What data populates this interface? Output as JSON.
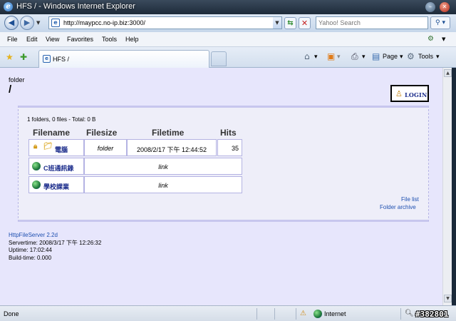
{
  "window": {
    "title": "HFS / - Windows Internet Explorer"
  },
  "address_bar": {
    "url": "http://maypcc.no-ip.biz:3000/",
    "search_placeholder": "Yahoo! Search"
  },
  "menu": {
    "items": [
      "File",
      "Edit",
      "View",
      "Favorites",
      "Tools",
      "Help"
    ]
  },
  "tabs": {
    "active_label": "HFS /"
  },
  "command_bar": {
    "page_label": "Page",
    "tools_label": "Tools"
  },
  "page": {
    "folder_label": "folder",
    "folder_path": "/",
    "login_label": "LOGIN",
    "summary": "1 folders, 0 files - Total: 0 B",
    "columns": [
      "Filename",
      "Filesize",
      "Filetime",
      "Hits"
    ],
    "rows": [
      {
        "name": "電腦",
        "size": "folder",
        "time": "2008/2/17 下午 12:44:52",
        "hits": "35",
        "type": "folder"
      },
      {
        "name": "C班通訊錄",
        "size": "link",
        "type": "link"
      },
      {
        "name": "學校課業",
        "size": "link",
        "type": "link"
      }
    ],
    "file_list_link": "File list",
    "folder_archive_link": "Folder archive",
    "footer": {
      "server_link": "HttpFileServer 2.2d",
      "servertime": "Servertime: 2008/3/17 下午 12:26:32",
      "uptime": "Uptime: 17:02:44",
      "buildtime": "Build-time: 0.000"
    }
  },
  "status_bar": {
    "status": "Done",
    "zone": "Internet"
  },
  "watermark": "#382801"
}
